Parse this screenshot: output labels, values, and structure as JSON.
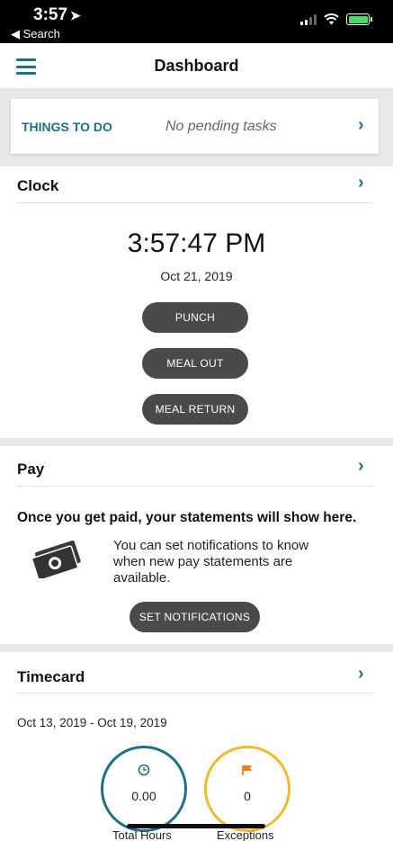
{
  "status_bar": {
    "time": "3:57",
    "back_label": "Search"
  },
  "header": {
    "title": "Dashboard"
  },
  "things_to_do": {
    "label": "THINGS TO DO",
    "status": "No pending tasks"
  },
  "clock": {
    "title": "Clock",
    "time": "3:57:47 PM",
    "date": "Oct 21, 2019",
    "buttons": {
      "punch": "PUNCH",
      "meal_out": "MEAL OUT",
      "meal_return": "MEAL RETURN"
    }
  },
  "pay": {
    "title": "Pay",
    "message": "Once you get paid, your statements will show here.",
    "info": "You can set notifications to know when new pay statements are available.",
    "button": "SET NOTIFICATIONS"
  },
  "timecard": {
    "title": "Timecard",
    "range": "Oct 13, 2019 - Oct 19, 2019",
    "total_hours": {
      "value": "0.00",
      "label": "Total Hours"
    },
    "exceptions": {
      "value": "0",
      "label": "Exceptions"
    }
  },
  "colors": {
    "accent": "#1f6f8b",
    "button": "#4a4a4a",
    "exceptions_ring": "#f0b82a",
    "flag": "#f07f1e"
  }
}
